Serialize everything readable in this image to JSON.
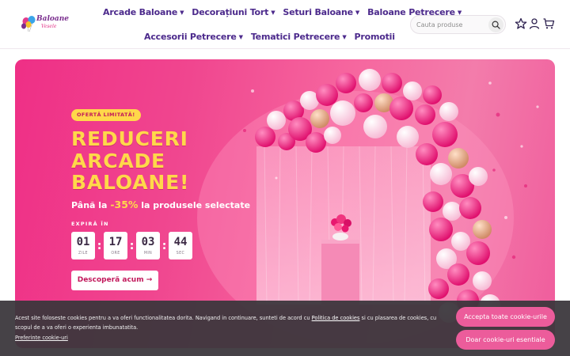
{
  "brand": {
    "logo_text": "Baloane",
    "logo_sub": "Vesele"
  },
  "nav": {
    "row1": [
      "Arcade Baloane",
      "Decorațiuni Tort",
      "Seturi Baloane",
      "Baloane Petrecere"
    ],
    "row2": [
      "Accesorii Petrecere",
      "Tematici Petrecere",
      "Promotii"
    ]
  },
  "search": {
    "placeholder": "Cauta produse",
    "icon": "search-icon"
  },
  "header_icons": [
    "star-icon",
    "user-icon",
    "cart-icon"
  ],
  "hero": {
    "badge": "OFERTĂ LIMITATĂ!",
    "headline": [
      "REDUCERI",
      "ARCADE",
      "BALOANE!"
    ],
    "sub_prefix": "Până la",
    "sub_pct": "-35%",
    "sub_suffix": "la produsele selectate",
    "expires_label": "EXPIRĂ ÎN",
    "countdown": [
      {
        "value": "01",
        "label": "ZILE"
      },
      {
        "value": "17",
        "label": "ORE"
      },
      {
        "value": "03",
        "label": "MIN"
      },
      {
        "value": "44",
        "label": "SEC"
      }
    ],
    "cta": "Descoperă acum →"
  },
  "cookie": {
    "text_before": "Acest site foloseste cookies pentru a va oferi functionalitatea dorita. Navigand in continuare, sunteti de acord cu ",
    "link": "Politica de cookies",
    "text_after": " si cu plasarea de cookies, cu scopul de a va oferi o experienta imbunatatita.",
    "preferences": "Preferinte cookie-uri",
    "accept_all": "Accepta toate cookie-urile",
    "essential_only": "Doar cookie-uri esentiale"
  },
  "colors": {
    "nav": "#4c2a8c",
    "hero_pink": "#ef2f86",
    "accent_yellow": "#ffd84a",
    "cookie_button": "#ec5c9b",
    "cookie_bg": "#3a363c"
  }
}
